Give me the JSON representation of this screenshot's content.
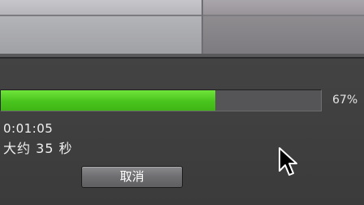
{
  "progress": {
    "fraction": 0.67,
    "percent_label": "67%",
    "fill_color": "#4ccb1f",
    "track_color": "#555557"
  },
  "time": {
    "elapsed": "0:01:05",
    "remaining": "大约 35 秒"
  },
  "buttons": {
    "cancel_label": "取消"
  },
  "icons": {
    "cursor": "mouse-pointer-icon"
  }
}
